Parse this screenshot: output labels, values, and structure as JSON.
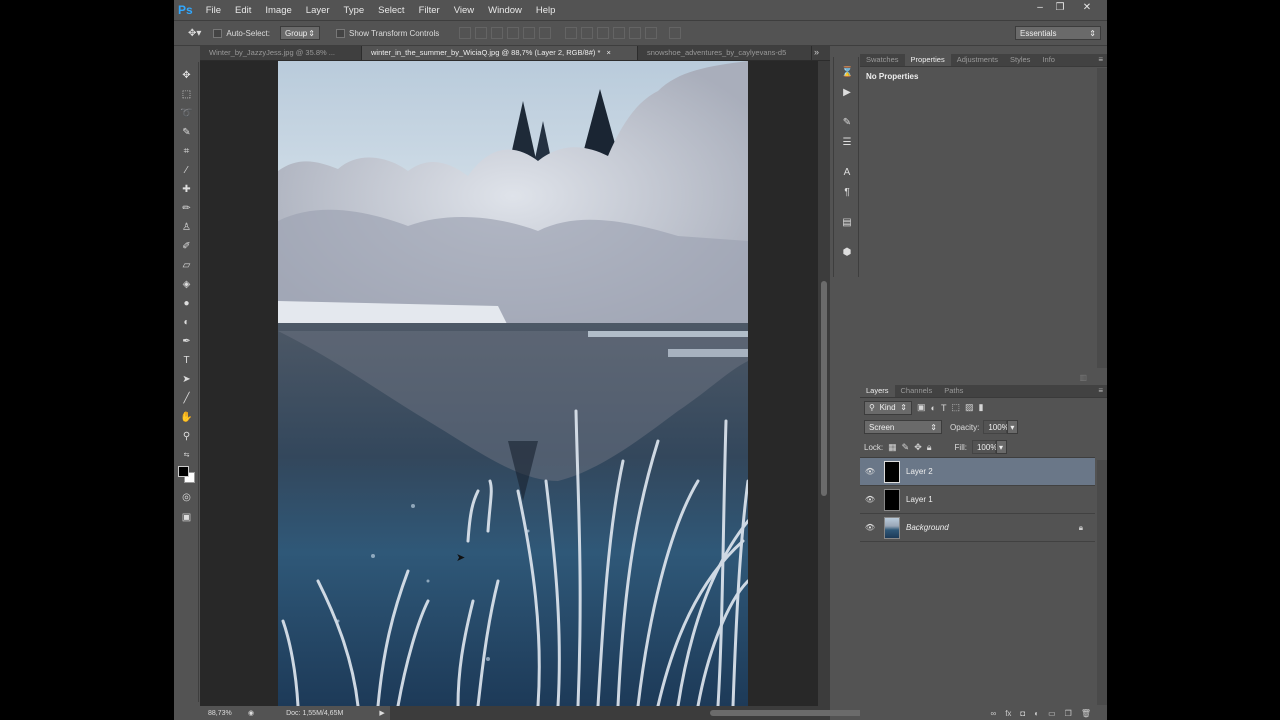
{
  "app": {
    "logo": "Ps"
  },
  "menu": [
    "File",
    "Edit",
    "Image",
    "Layer",
    "Type",
    "Select",
    "Filter",
    "View",
    "Window",
    "Help"
  ],
  "window_controls": {
    "minimize": "–",
    "restore": "❐",
    "close": "✕"
  },
  "options_bar": {
    "auto_select_label": "Auto-Select:",
    "auto_select_value": "Group",
    "transform_label": "Show Transform Controls",
    "workspace": "Essentials"
  },
  "doc_tabs": [
    {
      "label": "Winter_by_JazzyJess.jpg @ 35.8% ...",
      "active": false
    },
    {
      "label": "winter_in_the_summer_by_WiciaQ.jpg @ 88,7% (Layer 2, RGB/8#) *",
      "active": true
    },
    {
      "label": "snowshoe_adventures_by_caylyevans-d5",
      "active": false
    }
  ],
  "tab_close": "×",
  "tab_overflow": "»",
  "status": {
    "zoom": "88,73%",
    "doc": "Doc: 1,55M/4,65M"
  },
  "properties_panel": {
    "tabs": [
      "Swatches",
      "Properties",
      "Adjustments",
      "Styles",
      "Info"
    ],
    "active_tab": "Properties",
    "content": "No Properties"
  },
  "layers_panel": {
    "tabs": [
      "Layers",
      "Channels",
      "Paths"
    ],
    "active_tab": "Layers",
    "filter": "Kind",
    "blend_mode": "Screen",
    "opacity_label": "Opacity:",
    "opacity_value": "100%",
    "lock_label": "Lock:",
    "fill_label": "Fill:",
    "fill_value": "100%",
    "layers": [
      {
        "name": "Layer 2",
        "selected": true
      },
      {
        "name": "Layer 1",
        "selected": false
      },
      {
        "name": "Background",
        "selected": false
      }
    ]
  },
  "colors": {
    "accent": "#31a8ff",
    "selected_layer": "#6a7788",
    "ui_bg": "#535353"
  }
}
